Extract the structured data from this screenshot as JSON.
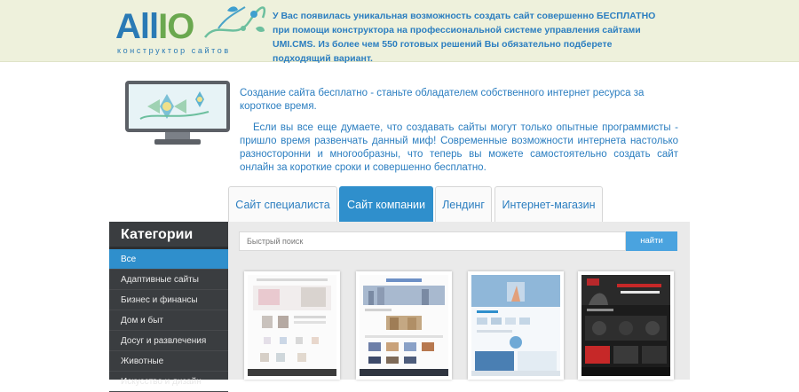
{
  "header": {
    "logo_text_a": "All",
    "logo_text_io": "IO",
    "logo_subtitle": "конструктор сайтов",
    "text": "У Вас появилась уникальная возможность создать сайт совершенно БЕСПЛАТНО при помощи конструктора на профессиональной системе управления сайтами UMI.CMS. Из более чем 550 готовых решений Вы обязательно подберете подходящий вариант."
  },
  "intro": {
    "lead": "Создание сайта бесплатно - станьте обладателем собственного интернет ресурса за короткое время.",
    "body": "Если вы все еще думаете, что создавать сайты могут только опытные программисты - пришло время развенчать данный миф! Современные возможности интернета настолько разносторонни и многообразны, что теперь вы можете самостоятельно создать сайт онлайн за короткие сроки и совершенно бесплатно."
  },
  "tabs": [
    {
      "label": "Сайт специалиста",
      "active": false
    },
    {
      "label": "Сайт компании",
      "active": true
    },
    {
      "label": "Лендинг",
      "active": false
    },
    {
      "label": "Интернет-магазин",
      "active": false
    }
  ],
  "sidebar": {
    "title": "Категории",
    "items": [
      {
        "label": "Все",
        "active": true
      },
      {
        "label": "Адаптивные сайты",
        "active": false
      },
      {
        "label": "Бизнес и финансы",
        "active": false
      },
      {
        "label": "Дом и быт",
        "active": false
      },
      {
        "label": "Досуг и развлечения",
        "active": false
      },
      {
        "label": "Животные",
        "active": false
      },
      {
        "label": "Искусство и дизайн",
        "active": false
      }
    ]
  },
  "search": {
    "placeholder": "Быстрый поиск",
    "button_label": "найти"
  },
  "templates": [
    {
      "name": "template-1",
      "theme": "light-shop"
    },
    {
      "name": "template-2",
      "theme": "city-corporate"
    },
    {
      "name": "template-3",
      "theme": "fitness-blue"
    },
    {
      "name": "template-4",
      "theme": "dark-gym"
    }
  ],
  "colors": {
    "accent": "#2f8fcc",
    "header_bg": "#eef1dc",
    "text_blue": "#2b7ec0",
    "sidebar_bg": "#3a3d40",
    "panel_bg": "#eaeaea",
    "search_button": "#4aa3df"
  }
}
